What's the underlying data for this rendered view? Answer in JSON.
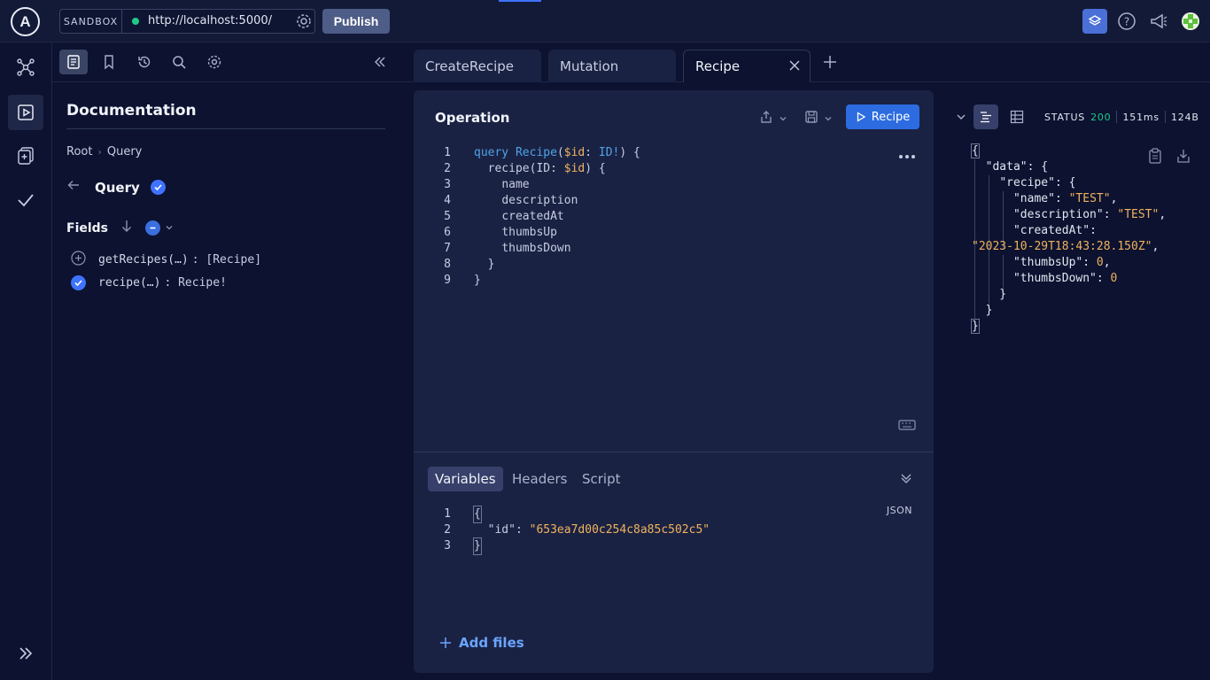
{
  "topbar": {
    "sandbox_label": "SANDBOX",
    "endpoint_url": "http://localhost:5000/",
    "publish_label": "Publish"
  },
  "docs": {
    "title": "Documentation",
    "breadcrumb": [
      "Root",
      "Query"
    ],
    "query_title": "Query",
    "fields_title": "Fields",
    "fields": [
      {
        "name": "getRecipes(…)",
        "type": ": [Recipe]",
        "selected": false
      },
      {
        "name": "recipe(…)",
        "type": ": Recipe!",
        "selected": true
      }
    ]
  },
  "tabs": [
    {
      "label": "CreateRecipe",
      "active": false
    },
    {
      "label": "Mutation",
      "active": false
    },
    {
      "label": "Recipe",
      "active": true
    }
  ],
  "operation": {
    "title": "Operation",
    "run_label": "Recipe",
    "line_numbers": [
      "1",
      "2",
      "3",
      "4",
      "5",
      "6",
      "7",
      "8",
      "9"
    ],
    "code": {
      "l1_kw": "query",
      "l1_name": "Recipe",
      "l1_var": "$id",
      "l1_type": "ID!",
      "l2_field": "recipe",
      "l2_arg": "ID",
      "l2_var": "$id",
      "fields": [
        "name",
        "description",
        "createdAt",
        "thumbsUp",
        "thumbsDown"
      ]
    }
  },
  "variables": {
    "tabs": [
      "Variables",
      "Headers",
      "Script"
    ],
    "active_tab": "Variables",
    "format_label": "JSON",
    "line_numbers": [
      "1",
      "2",
      "3"
    ],
    "key": "\"id\"",
    "value": "\"653ea7d00c254c8a85c502c5\"",
    "add_files_label": "Add files"
  },
  "response": {
    "status_label": "STATUS",
    "status_code": "200",
    "time": "151ms",
    "size": "124B",
    "json": {
      "data_key": "\"data\"",
      "recipe_key": "\"recipe\"",
      "name_key": "\"name\"",
      "name_val": "\"TEST\"",
      "description_key": "\"description\"",
      "description_val": "\"TEST\"",
      "createdAt_key": "\"createdAt\"",
      "createdAt_val": "\"2023-10-29T18:43:28.150Z\"",
      "thumbsUp_key": "\"thumbsUp\"",
      "thumbsUp_val": "0",
      "thumbsDown_key": "\"thumbsDown\"",
      "thumbsDown_val": "0"
    }
  },
  "colors": {
    "background": "#0c1230",
    "panel": "#1a2244",
    "accent": "#3f73ff",
    "run_button": "#2c6ce0",
    "status_ok": "#1ec987",
    "string": "#f0b35d",
    "keyword": "#4ea3e6"
  }
}
